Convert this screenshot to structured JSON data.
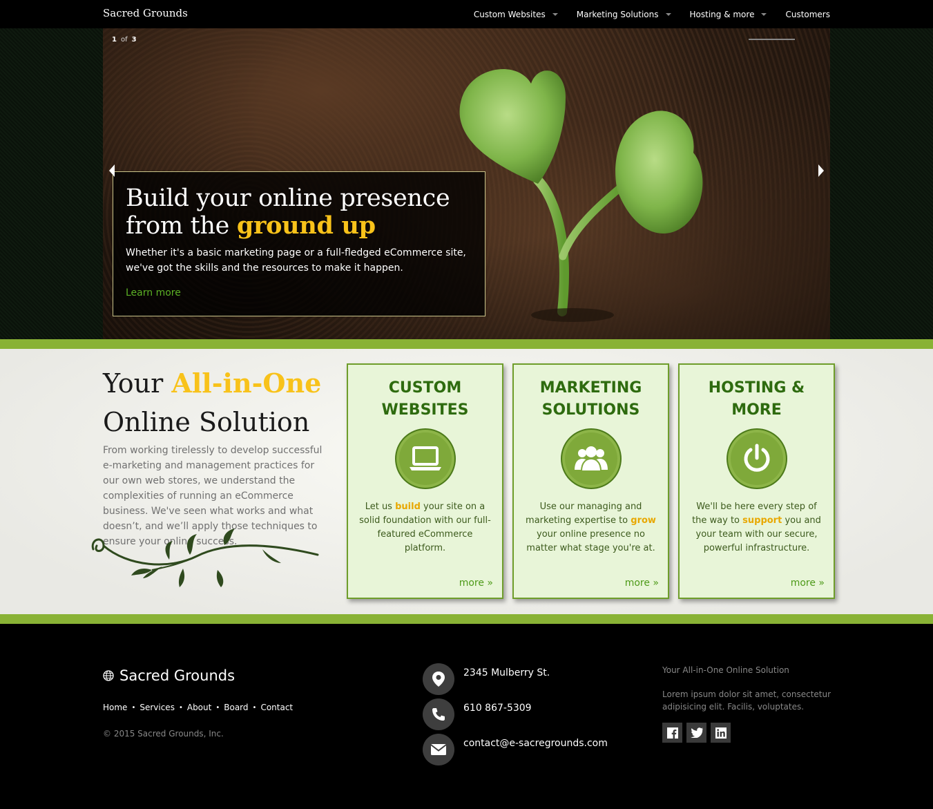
{
  "navbar": {
    "brand": "Sacred Grounds",
    "items": [
      {
        "label": "Custom Websites",
        "dropdown": true
      },
      {
        "label": "Marketing Solutions",
        "dropdown": true
      },
      {
        "label": "Hosting & more",
        "dropdown": true
      },
      {
        "label": "Customers",
        "dropdown": false
      }
    ]
  },
  "hero": {
    "slide_current": "1",
    "slide_of": "of",
    "slide_total": "3",
    "title_line1": "Build your online presence",
    "title_line2_prefix": "from the ",
    "title_line2_highlight": "ground up",
    "text": "Whether it's a basic marketing page or a full-fledged eCommerce site, we've got the skills and the resources to make it happen.",
    "link": "Learn more"
  },
  "intro": {
    "title_prefix": "Your ",
    "title_highlight": "All-in-One",
    "title_line2": "Online Solution",
    "text": "From working tirelessly to develop successful e-marketing and management practices for our own web stores, we understand the complexities of running an eCommerce business. We've seen what works and what doesn’t, and we’ll apply those techniques to ensure your online success."
  },
  "cards": [
    {
      "title_line1": "CUSTOM",
      "title_line2": "WEBSITES",
      "icon": "laptop-icon",
      "text_before": "Let us ",
      "highlight": "build",
      "text_after": " your site on a solid foundation with our full-featured eCommerce platform.",
      "more": "more »"
    },
    {
      "title_line1": "MARKETING",
      "title_line2": "SOLUTIONS",
      "icon": "users-icon",
      "text_before": "Use our managing and marketing expertise to ",
      "highlight": "grow",
      "text_after": " your online presence no matter what stage you're at.",
      "more": "more »"
    },
    {
      "title_line1": "HOSTING &",
      "title_line2": "MORE",
      "icon": "power-icon",
      "text_before": "We'll be here every step of the way to ",
      "highlight": "support",
      "text_after": " you and your team with our secure, powerful infrastructure.",
      "more": "more »"
    }
  ],
  "footer": {
    "brand": "Sacred Grounds",
    "links": [
      "Home",
      "Services",
      "About",
      "Board",
      "Contact"
    ],
    "copyright": "© 2015 Sacred Grounds, Inc.",
    "address": "2345 Mulberry St.",
    "phone": "610 867-5309",
    "email": "contact@e-sacregrounds.com",
    "tagline": "Your All-in-One Online Solution",
    "lorem": "Lorem ipsum dolor sit amet, consectetur adipisicing elit. Facilis, voluptates.",
    "social": [
      "facebook-icon",
      "twitter-icon",
      "linkedin-icon"
    ]
  },
  "colors": {
    "accent_green": "#89b235",
    "highlight_yellow": "#f8c21a",
    "link_green": "#5cb125",
    "card_bg": "#e8f5d8",
    "card_title": "#2e6b0f"
  }
}
